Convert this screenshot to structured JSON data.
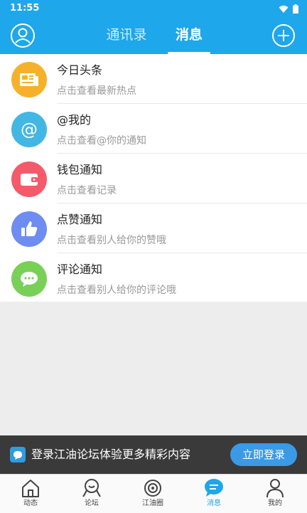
{
  "status_bar": {
    "time": "11:55"
  },
  "header": {
    "tabs": [
      {
        "label": "通讯录",
        "active": false
      },
      {
        "label": "消息",
        "active": true
      }
    ]
  },
  "messages": [
    {
      "title": "今日头条",
      "subtitle": "点击查看最新热点",
      "icon": "newspaper-icon",
      "color": "#f6b12b"
    },
    {
      "title": "@我的",
      "subtitle": "点击查看@你的通知",
      "icon": "at-icon",
      "color": "#43b7e4"
    },
    {
      "title": "钱包通知",
      "subtitle": "点击查看记录",
      "icon": "wallet-icon",
      "color": "#f55a6b"
    },
    {
      "title": "点赞通知",
      "subtitle": "点击查看别人给你的赞哦",
      "icon": "thumbs-up-icon",
      "color": "#6f8cf2"
    },
    {
      "title": "评论通知",
      "subtitle": "点击查看别人给你的评论哦",
      "icon": "comment-icon",
      "color": "#79d056"
    }
  ],
  "login_banner": {
    "text": "登录江油论坛体验更多精彩内容",
    "button": "立即登录"
  },
  "bottom_nav": [
    {
      "label": "动态",
      "icon": "home-icon",
      "active": false
    },
    {
      "label": "论坛",
      "icon": "forum-icon",
      "active": false
    },
    {
      "label": "江油圈",
      "icon": "circle-icon",
      "active": false
    },
    {
      "label": "消息",
      "icon": "message-icon",
      "active": true
    },
    {
      "label": "我的",
      "icon": "profile-icon",
      "active": false
    }
  ],
  "colors": {
    "primary": "#1ea7ea",
    "banner_bg": "#3a3a3a",
    "page_bg": "#ededed"
  }
}
